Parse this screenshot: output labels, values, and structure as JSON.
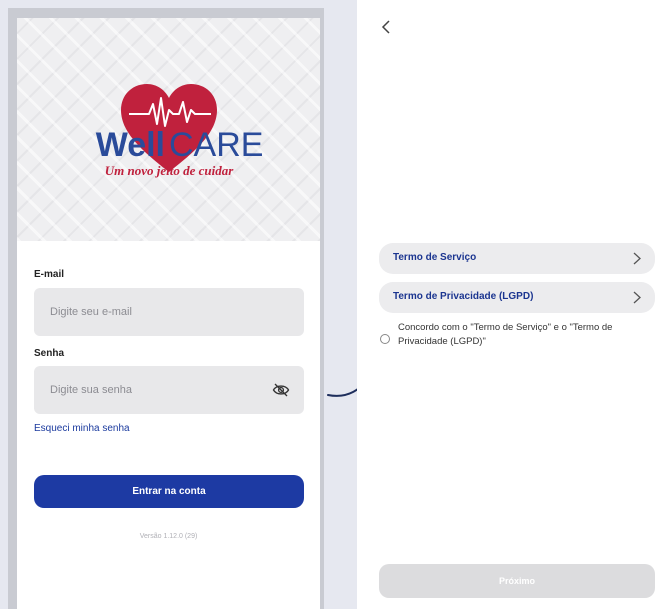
{
  "login": {
    "logo": {
      "brand_part1": "Well",
      "brand_part2": "CARE",
      "tagline": "Um novo jeito de cuidar"
    },
    "email_label": "E-mail",
    "email_placeholder": "Digite seu e-mail",
    "password_label": "Senha",
    "password_placeholder": "Digite sua senha",
    "password_toggle_icon": "eye-off-icon",
    "forgot_password": "Esqueci minha senha",
    "login_button": "Entrar na conta",
    "version": "Versão 1.12.0 (29)"
  },
  "terms": {
    "back_icon": "chevron-left-icon",
    "items": [
      {
        "label": "Termo de Serviço",
        "icon": "chevron-right-icon"
      },
      {
        "label": "Termo de Privacidade (LGPD)",
        "icon": "chevron-right-icon"
      }
    ],
    "agree_text": "Concordo com o \"Termo de Serviço\" e o \"Termo de Privacidade (LGPD)\"",
    "agree_checked": false,
    "next_button": "Próximo",
    "next_enabled": false
  },
  "colors": {
    "primary": "#1d3aa3",
    "link": "#1b3a9e",
    "term_text": "#1b3590",
    "logo_red": "#c0213d",
    "logo_blue": "#2a4b9a",
    "disabled_button": "#dcdcde",
    "canvas": "#e6e8f0"
  }
}
